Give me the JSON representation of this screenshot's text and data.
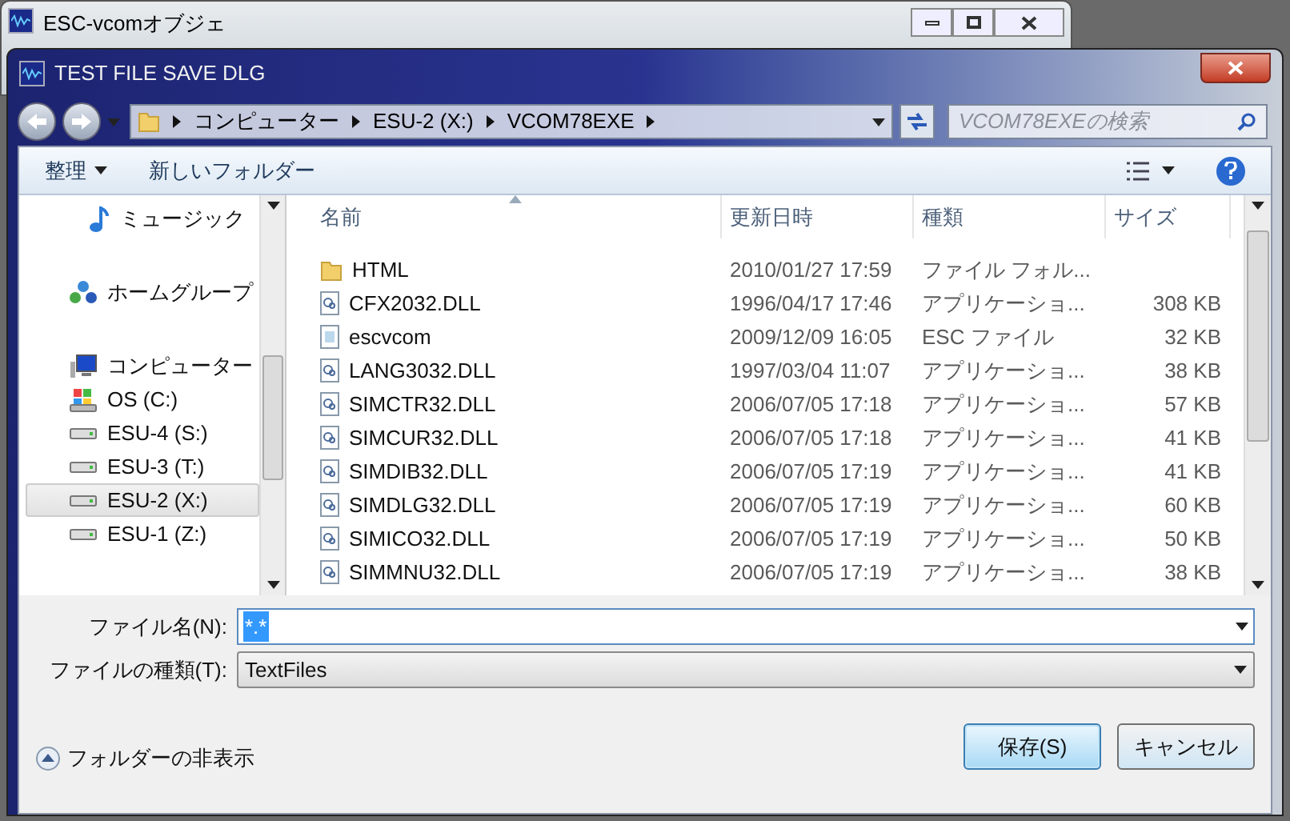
{
  "background_window": {
    "title": "ESC-vcomオブジェ"
  },
  "dialog": {
    "title": "TEST FILE SAVE DLG"
  },
  "breadcrumb": [
    "コンピューター",
    "ESU-2 (X:)",
    "VCOM78EXE"
  ],
  "search": {
    "placeholder": "VCOM78EXEの検索"
  },
  "toolbar": {
    "organize": "整理",
    "new_folder": "新しいフォルダー"
  },
  "sidebar": {
    "items": [
      {
        "kind": "music",
        "label": "ミュージック",
        "selected": false
      },
      {
        "kind": "homegroup",
        "label": "ホームグループ",
        "selected": false
      },
      {
        "kind": "computer",
        "label": "コンピューター",
        "selected": false
      },
      {
        "kind": "os-drive",
        "label": "OS (C:)",
        "selected": false
      },
      {
        "kind": "drive",
        "label": "ESU-4 (S:)",
        "selected": false
      },
      {
        "kind": "drive",
        "label": "ESU-3 (T:)",
        "selected": false
      },
      {
        "kind": "drive",
        "label": "ESU-2 (X:)",
        "selected": true
      },
      {
        "kind": "drive",
        "label": "ESU-1 (Z:)",
        "selected": false
      }
    ]
  },
  "table": {
    "columns": [
      "名前",
      "更新日時",
      "種類",
      "サイズ"
    ],
    "rows": [
      {
        "kind": "folder",
        "name": "HTML",
        "date": "2010/01/27 17:59",
        "type": "ファイル フォル...",
        "size": ""
      },
      {
        "kind": "dll",
        "name": "CFX2032.DLL",
        "date": "1996/04/17 17:46",
        "type": "アプリケーショ...",
        "size": "308 KB"
      },
      {
        "kind": "file",
        "name": "escvcom",
        "date": "2009/12/09 16:05",
        "type": "ESC ファイル",
        "size": "32 KB"
      },
      {
        "kind": "dll",
        "name": "LANG3032.DLL",
        "date": "1997/03/04 11:07",
        "type": "アプリケーショ...",
        "size": "38 KB"
      },
      {
        "kind": "dll",
        "name": "SIMCTR32.DLL",
        "date": "2006/07/05 17:18",
        "type": "アプリケーショ...",
        "size": "57 KB"
      },
      {
        "kind": "dll",
        "name": "SIMCUR32.DLL",
        "date": "2006/07/05 17:18",
        "type": "アプリケーショ...",
        "size": "41 KB"
      },
      {
        "kind": "dll",
        "name": "SIMDIB32.DLL",
        "date": "2006/07/05 17:19",
        "type": "アプリケーショ...",
        "size": "41 KB"
      },
      {
        "kind": "dll",
        "name": "SIMDLG32.DLL",
        "date": "2006/07/05 17:19",
        "type": "アプリケーショ...",
        "size": "60 KB"
      },
      {
        "kind": "dll",
        "name": "SIMICO32.DLL",
        "date": "2006/07/05 17:19",
        "type": "アプリケーショ...",
        "size": "50 KB"
      },
      {
        "kind": "dll",
        "name": "SIMMNU32.DLL",
        "date": "2006/07/05 17:19",
        "type": "アプリケーショ...",
        "size": "38 KB"
      }
    ]
  },
  "file_name": {
    "label": "ファイル名(N):",
    "value": "*.*"
  },
  "file_type": {
    "label": "ファイルの種類(T):",
    "value": "TextFiles"
  },
  "hide_folders": "フォルダーの非表示",
  "buttons": {
    "save": "保存(S)",
    "cancel": "キャンセル"
  }
}
